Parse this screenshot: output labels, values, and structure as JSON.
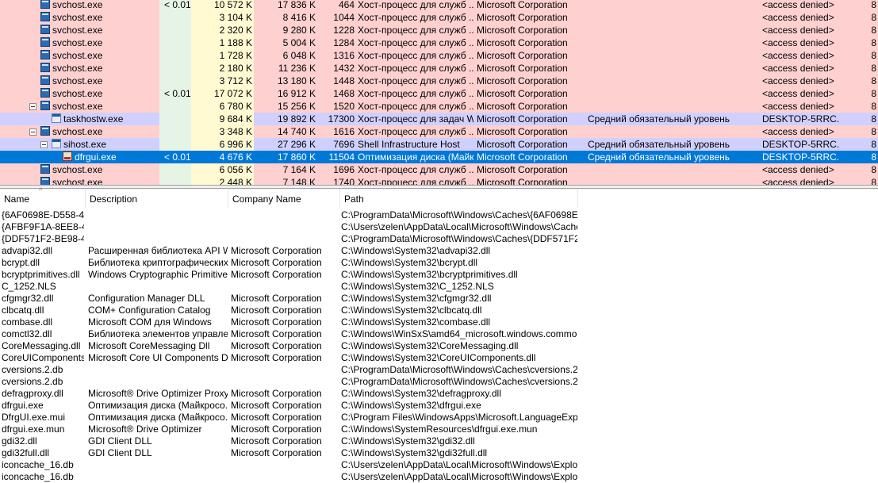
{
  "process_columns": {
    "colors": {
      "service_row": "#ffd0d0",
      "own_row": "#d0d0ff",
      "selected_row": "#0078d7",
      "cpu_column": "#e6f4e6",
      "private_bytes_column": "#fffad2"
    }
  },
  "processes": [
    {
      "name": "svchost.exe",
      "cpu": "< 0.01",
      "private_bytes": "10 572 K",
      "working_set": "17 836 K",
      "pid": "464",
      "description": "Хост-процесс для служб ...",
      "company": "Microsoft Corporation",
      "integrity": "",
      "user": "<access denied>",
      "session": "8",
      "style": "svc",
      "indent": 0,
      "toggle": false,
      "icon": "svc-icon"
    },
    {
      "name": "svchost.exe",
      "cpu": "",
      "private_bytes": "3 104 K",
      "working_set": "8 416 K",
      "pid": "1044",
      "description": "Хост-процесс для служб ...",
      "company": "Microsoft Corporation",
      "integrity": "",
      "user": "<access denied>",
      "session": "8",
      "style": "svc",
      "indent": 0,
      "toggle": false,
      "icon": "svc-icon"
    },
    {
      "name": "svchost.exe",
      "cpu": "",
      "private_bytes": "2 320 K",
      "working_set": "9 280 K",
      "pid": "1228",
      "description": "Хост-процесс для служб ...",
      "company": "Microsoft Corporation",
      "integrity": "",
      "user": "<access denied>",
      "session": "8",
      "style": "svc",
      "indent": 0,
      "toggle": false,
      "icon": "svc-icon"
    },
    {
      "name": "svchost.exe",
      "cpu": "",
      "private_bytes": "1 188 K",
      "working_set": "5 004 K",
      "pid": "1284",
      "description": "Хост-процесс для служб ...",
      "company": "Microsoft Corporation",
      "integrity": "",
      "user": "<access denied>",
      "session": "8",
      "style": "svc",
      "indent": 0,
      "toggle": false,
      "icon": "svc-icon"
    },
    {
      "name": "svchost.exe",
      "cpu": "",
      "private_bytes": "1 728 K",
      "working_set": "6 048 K",
      "pid": "1316",
      "description": "Хост-процесс для служб ...",
      "company": "Microsoft Corporation",
      "integrity": "",
      "user": "<access denied>",
      "session": "8",
      "style": "svc",
      "indent": 0,
      "toggle": false,
      "icon": "svc-icon"
    },
    {
      "name": "svchost.exe",
      "cpu": "",
      "private_bytes": "2 180 K",
      "working_set": "11 236 K",
      "pid": "1432",
      "description": "Хост-процесс для служб ...",
      "company": "Microsoft Corporation",
      "integrity": "",
      "user": "<access denied>",
      "session": "8",
      "style": "svc",
      "indent": 0,
      "toggle": false,
      "icon": "svc-icon"
    },
    {
      "name": "svchost.exe",
      "cpu": "",
      "private_bytes": "3 712 K",
      "working_set": "13 180 K",
      "pid": "1448",
      "description": "Хост-процесс для служб ...",
      "company": "Microsoft Corporation",
      "integrity": "",
      "user": "<access denied>",
      "session": "8",
      "style": "svc",
      "indent": 0,
      "toggle": false,
      "icon": "svc-icon"
    },
    {
      "name": "svchost.exe",
      "cpu": "< 0.01",
      "private_bytes": "17 072 K",
      "working_set": "16 912 K",
      "pid": "1468",
      "description": "Хост-процесс для служб ...",
      "company": "Microsoft Corporation",
      "integrity": "",
      "user": "<access denied>",
      "session": "8",
      "style": "svc",
      "indent": 0,
      "toggle": false,
      "icon": "svc-icon"
    },
    {
      "name": "svchost.exe",
      "cpu": "",
      "private_bytes": "6 780 K",
      "working_set": "15 256 K",
      "pid": "1520",
      "description": "Хост-процесс для служб ...",
      "company": "Microsoft Corporation",
      "integrity": "",
      "user": "<access denied>",
      "session": "8",
      "style": "svc",
      "indent": 0,
      "toggle": true,
      "icon": "svc-icon"
    },
    {
      "name": "taskhostw.exe",
      "cpu": "",
      "private_bytes": "9 684 K",
      "working_set": "19 892 K",
      "pid": "17300",
      "description": "Хост-процесс для задач W...",
      "company": "Microsoft Corporation",
      "integrity": "Средний обязательный уровень",
      "user": "DESKTOP-5RRC...",
      "session": "8",
      "style": "own",
      "indent": 1,
      "toggle": false,
      "icon": "window-icon"
    },
    {
      "name": "svchost.exe",
      "cpu": "",
      "private_bytes": "3 348 K",
      "working_set": "14 740 K",
      "pid": "1616",
      "description": "Хост-процесс для служб ...",
      "company": "Microsoft Corporation",
      "integrity": "",
      "user": "<access denied>",
      "session": "8",
      "style": "svc",
      "indent": 0,
      "toggle": true,
      "icon": "svc-icon"
    },
    {
      "name": "sihost.exe",
      "cpu": "",
      "private_bytes": "6 996 K",
      "working_set": "27 296 K",
      "pid": "7696",
      "description": "Shell Infrastructure Host",
      "company": "Microsoft Corporation",
      "integrity": "Средний обязательный уровень",
      "user": "DESKTOP-5RRC...",
      "session": "8",
      "style": "own",
      "indent": 1,
      "toggle": true,
      "icon": "window-icon"
    },
    {
      "name": "dfrgui.exe",
      "cpu": "< 0.01",
      "private_bytes": "4 676 K",
      "working_set": "17 860 K",
      "pid": "11504",
      "description": "Оптимизация диска (Майк...",
      "company": "Microsoft Corporation",
      "integrity": "Средний обязательный уровень",
      "user": "DESKTOP-5RRC...",
      "session": "8",
      "style": "sel",
      "indent": 2,
      "toggle": false,
      "icon": "defrag-icon"
    },
    {
      "name": "svchost.exe",
      "cpu": "",
      "private_bytes": "6 056 K",
      "working_set": "7 164 K",
      "pid": "1696",
      "description": "Хост-процесс для служб ...",
      "company": "Microsoft Corporation",
      "integrity": "",
      "user": "<access denied>",
      "session": "8",
      "style": "svc",
      "indent": 0,
      "toggle": false,
      "icon": "svc-icon"
    },
    {
      "name": "svchost.exe",
      "cpu": "",
      "private_bytes": "2 448 K",
      "working_set": "7 148 K",
      "pid": "1740",
      "description": "Хост-процесс для служб ...",
      "company": "Microsoft Corporation",
      "integrity": "",
      "user": "<access denied>",
      "session": "8",
      "style": "svc",
      "indent": 0,
      "toggle": false,
      "icon": "svc-icon"
    }
  ],
  "dll_header": {
    "name": "Name",
    "description": "Description",
    "company": "Company Name",
    "path": "Path"
  },
  "dlls": [
    {
      "name": "{6AF0698E-D558-4...",
      "description": "",
      "company": "",
      "path": "C:\\ProgramData\\Microsoft\\Windows\\Caches\\{6AF0698E-D..."
    },
    {
      "name": "{AFBF9F1A-8EE8-4...",
      "description": "",
      "company": "",
      "path": "C:\\Users\\zelen\\AppData\\Local\\Microsoft\\Windows\\Cache..."
    },
    {
      "name": "{DDF571F2-BE98-4...",
      "description": "",
      "company": "",
      "path": "C:\\ProgramData\\Microsoft\\Windows\\Caches\\{DDF571F2-..."
    },
    {
      "name": "advapi32.dll",
      "description": "Расширенная библиотека API W...",
      "company": "Microsoft Corporation",
      "path": "C:\\Windows\\System32\\advapi32.dll"
    },
    {
      "name": "bcrypt.dll",
      "description": "Библиотека криптографических...",
      "company": "Microsoft Corporation",
      "path": "C:\\Windows\\System32\\bcrypt.dll"
    },
    {
      "name": "bcryptprimitives.dll",
      "description": "Windows Cryptographic Primitives ...",
      "company": "Microsoft Corporation",
      "path": "C:\\Windows\\System32\\bcryptprimitives.dll"
    },
    {
      "name": "C_1252.NLS",
      "description": "",
      "company": "",
      "path": "C:\\Windows\\System32\\C_1252.NLS"
    },
    {
      "name": "cfgmgr32.dll",
      "description": "Configuration Manager DLL",
      "company": "Microsoft Corporation",
      "path": "C:\\Windows\\System32\\cfgmgr32.dll"
    },
    {
      "name": "clbcatq.dll",
      "description": "COM+ Configuration Catalog",
      "company": "Microsoft Corporation",
      "path": "C:\\Windows\\System32\\clbcatq.dll"
    },
    {
      "name": "combase.dll",
      "description": "Microsoft COM для Windows",
      "company": "Microsoft Corporation",
      "path": "C:\\Windows\\System32\\combase.dll"
    },
    {
      "name": "comctl32.dll",
      "description": "Библиотека элементов управле...",
      "company": "Microsoft Corporation",
      "path": "C:\\Windows\\WinSxS\\amd64_microsoft.windows.common-c..."
    },
    {
      "name": "CoreMessaging.dll",
      "description": "Microsoft CoreMessaging Dll",
      "company": "Microsoft Corporation",
      "path": "C:\\Windows\\System32\\CoreMessaging.dll"
    },
    {
      "name": "CoreUIComponents....",
      "description": "Microsoft Core UI Components Dll",
      "company": "Microsoft Corporation",
      "path": "C:\\Windows\\System32\\CoreUIComponents.dll"
    },
    {
      "name": "cversions.2.db",
      "description": "",
      "company": "",
      "path": "C:\\ProgramData\\Microsoft\\Windows\\Caches\\cversions.2.db"
    },
    {
      "name": "cversions.2.db",
      "description": "",
      "company": "",
      "path": "C:\\ProgramData\\Microsoft\\Windows\\Caches\\cversions.2.db"
    },
    {
      "name": "defragproxy.dll",
      "description": "Microsoft® Drive Optimizer Proxy Li...",
      "company": "Microsoft Corporation",
      "path": "C:\\Windows\\System32\\defragproxy.dll"
    },
    {
      "name": "dfrgui.exe",
      "description": "Оптимизация диска (Майкросо...",
      "company": "Microsoft Corporation",
      "path": "C:\\Windows\\System32\\dfrgui.exe"
    },
    {
      "name": "DfrgUI.exe.mui",
      "description": "Оптимизация диска (Майкросо...",
      "company": "Microsoft Corporation",
      "path": "C:\\Program Files\\WindowsApps\\Microsoft.LanguageExperie..."
    },
    {
      "name": "dfrgui.exe.mun",
      "description": "Microsoft® Drive Optimizer",
      "company": "Microsoft Corporation",
      "path": "C:\\Windows\\SystemResources\\dfrgui.exe.mun"
    },
    {
      "name": "gdi32.dll",
      "description": "GDI Client DLL",
      "company": "Microsoft Corporation",
      "path": "C:\\Windows\\System32\\gdi32.dll"
    },
    {
      "name": "gdi32full.dll",
      "description": "GDI Client DLL",
      "company": "Microsoft Corporation",
      "path": "C:\\Windows\\System32\\gdi32full.dll"
    },
    {
      "name": "iconcache_16.db",
      "description": "",
      "company": "",
      "path": "C:\\Users\\zelen\\AppData\\Local\\Microsoft\\Windows\\Explor..."
    },
    {
      "name": "iconcache_16.db",
      "description": "",
      "company": "",
      "path": "C:\\Users\\zelen\\AppData\\Local\\Microsoft\\Windows\\Explor..."
    }
  ]
}
